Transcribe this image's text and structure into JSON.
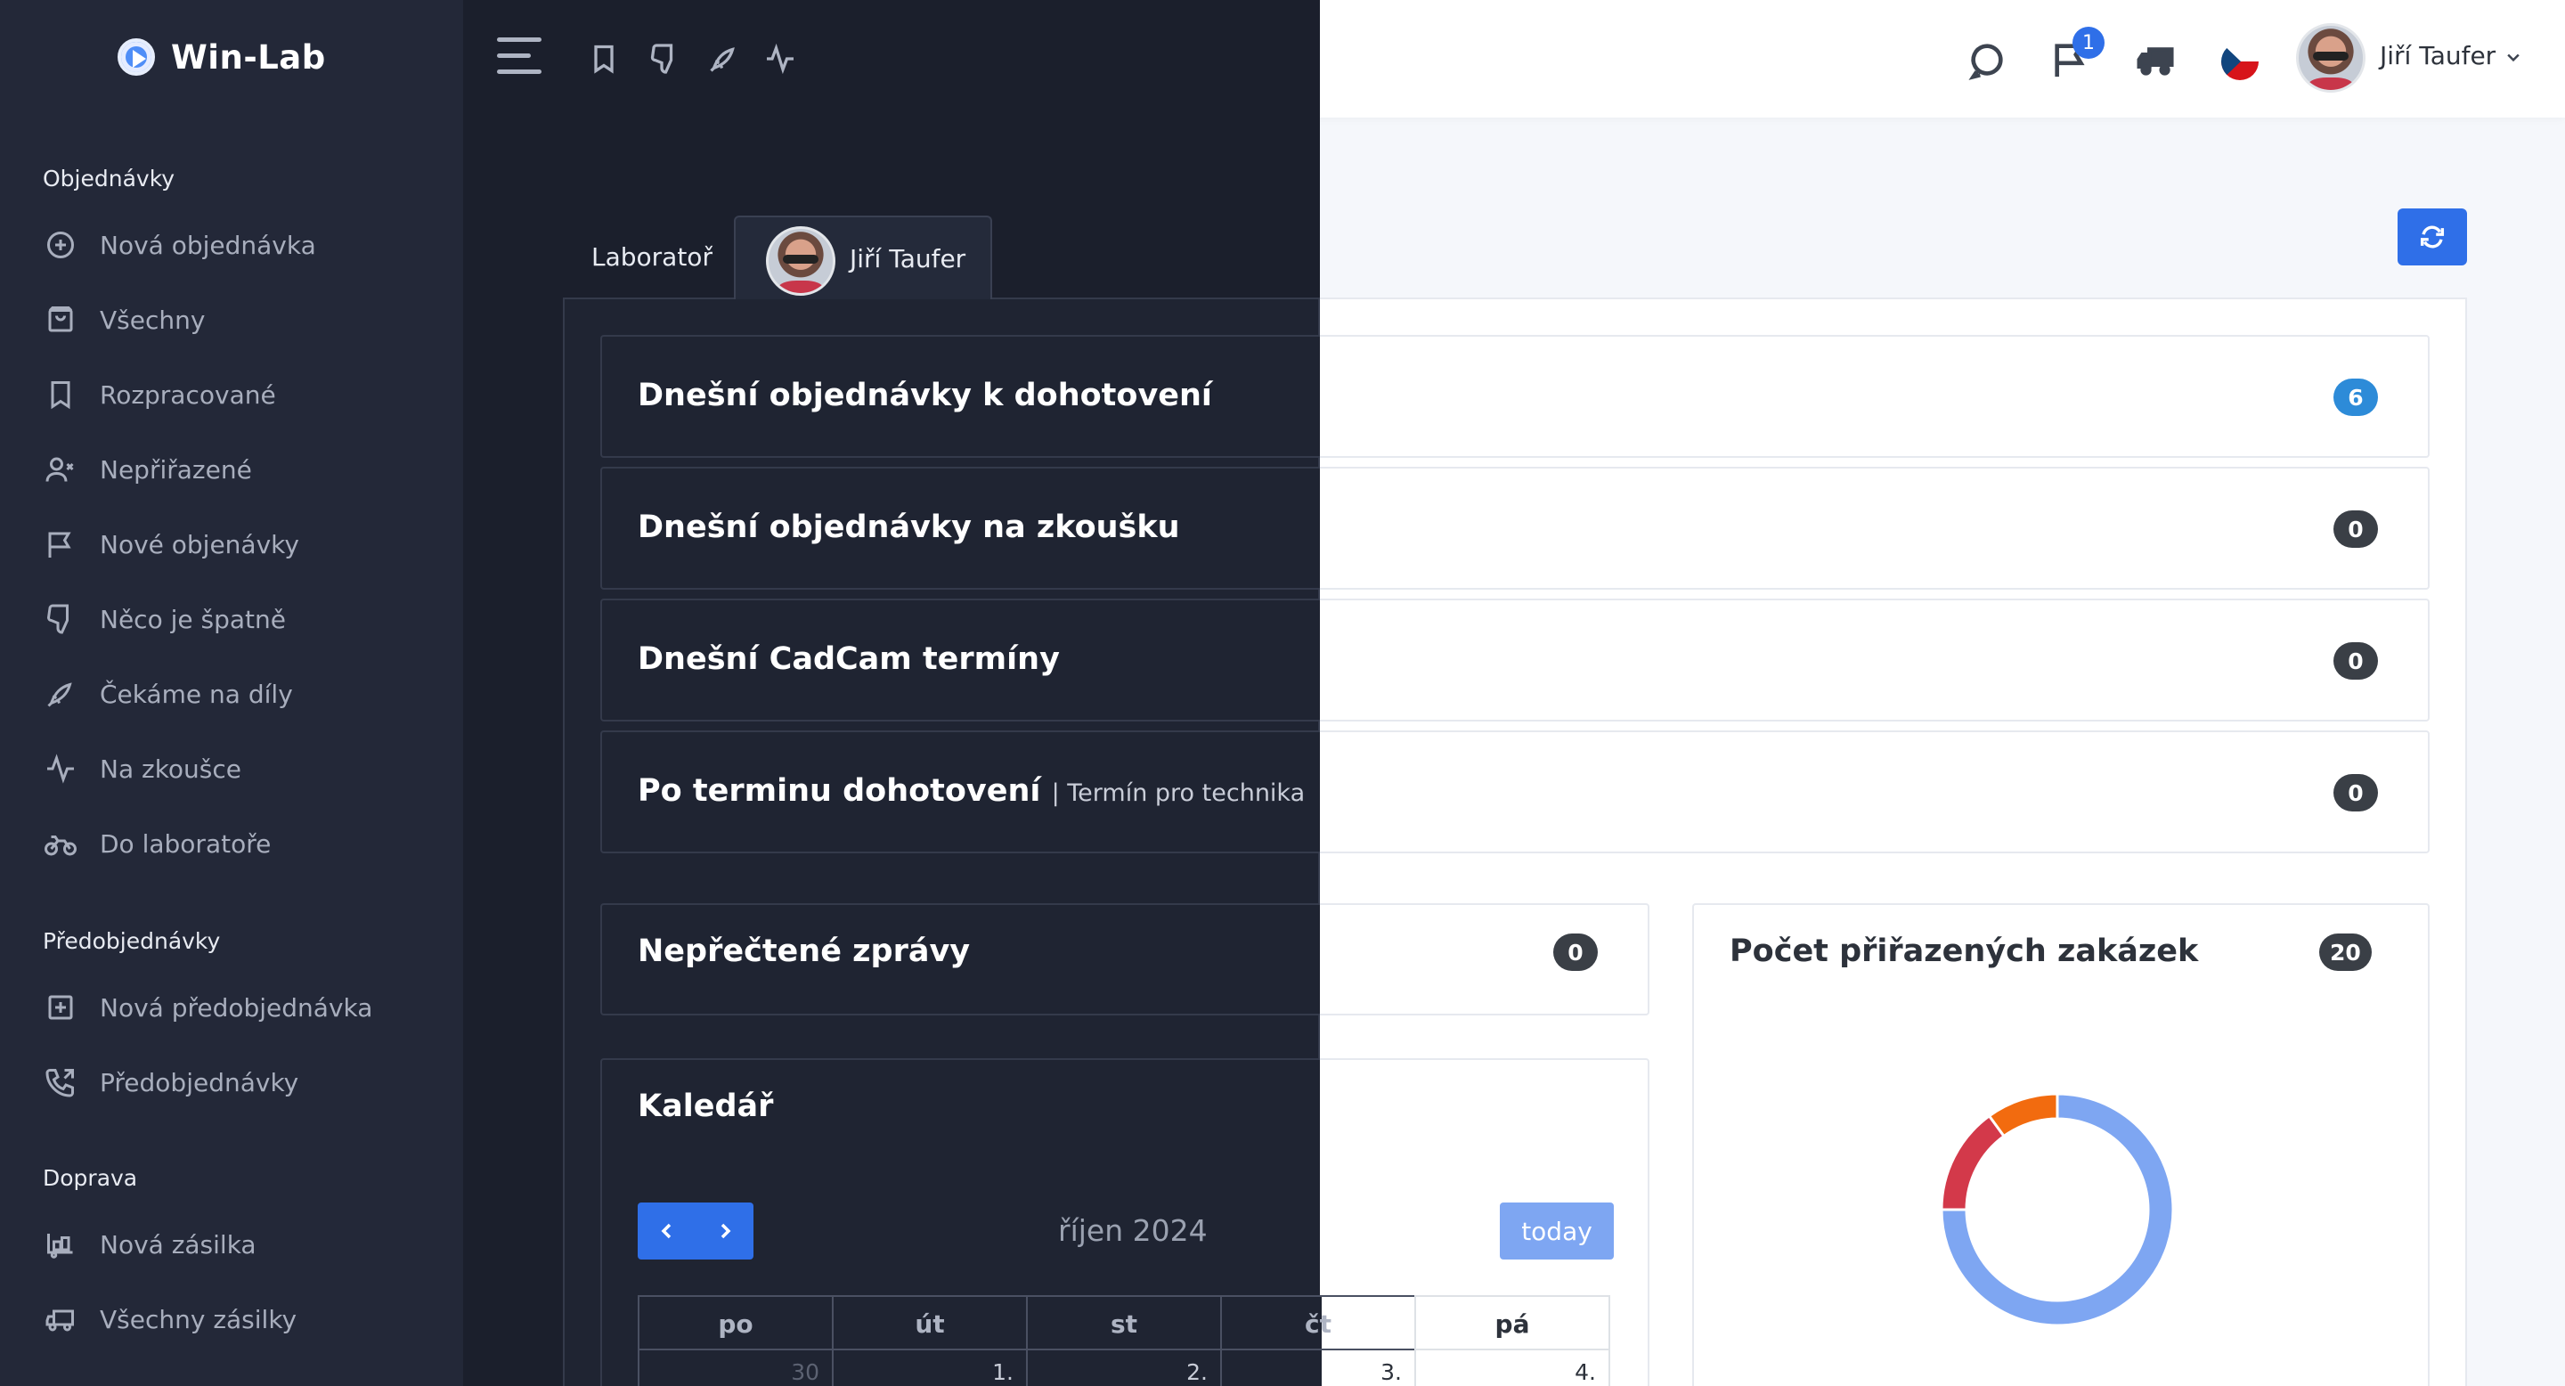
{
  "brand": {
    "name": "Win-Lab"
  },
  "sidebar": {
    "sections": [
      {
        "title": "Objednávky",
        "items": [
          {
            "label": "Nová objednávka",
            "icon": "plus-circle-icon"
          },
          {
            "label": "Všechny",
            "icon": "bag-icon"
          },
          {
            "label": "Rozpracované",
            "icon": "bookmark-icon"
          },
          {
            "label": "Nepřiřazené",
            "icon": "user-x-icon"
          },
          {
            "label": "Nové objenávky",
            "icon": "flag-icon"
          },
          {
            "label": "Něco je špatně",
            "icon": "thumbs-down-icon"
          },
          {
            "label": "Čekáme na díly",
            "icon": "rocket-icon"
          },
          {
            "label": "Na zkoušce",
            "icon": "activity-icon"
          },
          {
            "label": "Do laboratoře",
            "icon": "motorcycle-icon"
          }
        ]
      },
      {
        "title": "Předobjednávky",
        "items": [
          {
            "label": "Nová předobjednávka",
            "icon": "plus-square-icon"
          },
          {
            "label": "Předobjednávky",
            "icon": "phone-icon"
          }
        ]
      },
      {
        "title": "Doprava",
        "items": [
          {
            "label": "Nová zásilka",
            "icon": "truck-loading-icon"
          },
          {
            "label": "Všechny zásilky",
            "icon": "truck-icon"
          }
        ]
      }
    ]
  },
  "topbar": {
    "notification_count": "1",
    "user_name": "Jiří Taufer",
    "icons": [
      "message-circle-icon",
      "flag-icon",
      "truck-icon",
      "czech-flag-icon"
    ]
  },
  "tabs": [
    {
      "label": "Laboratoř"
    },
    {
      "label": "Jiří Taufer"
    }
  ],
  "stats": [
    {
      "title": "Dnešní objednávky k dohotovení",
      "sub": "",
      "count": "6",
      "color": "#2d8bd8"
    },
    {
      "title": "Dnešní objednávky na zkoušku",
      "sub": "",
      "count": "0",
      "color": "#3a3f46"
    },
    {
      "title": "Dnešní CadCam termíny",
      "sub": "",
      "count": "0",
      "color": "#3a3f46"
    },
    {
      "title": "Po terminu dohotovení",
      "sub": "| Termín pro technika",
      "count": "0",
      "color": "#3a3f46"
    }
  ],
  "unread": {
    "title": "Nepřečtené zprávy",
    "count": "0"
  },
  "assigned": {
    "title": "Počet přiřazených zakázek",
    "count": "20",
    "chart_data": {
      "type": "pie",
      "values": [
        15,
        3,
        2
      ],
      "colors": [
        "#7ea6f2",
        "#d3394a",
        "#f26b0f"
      ]
    }
  },
  "calendar": {
    "title": "Kaledář",
    "month": "říjen 2024",
    "today_label": "today",
    "days": [
      "po",
      "út",
      "st",
      "čt",
      "pá"
    ],
    "dates": [
      "30",
      "1.",
      "2.",
      "3.",
      "4."
    ]
  }
}
